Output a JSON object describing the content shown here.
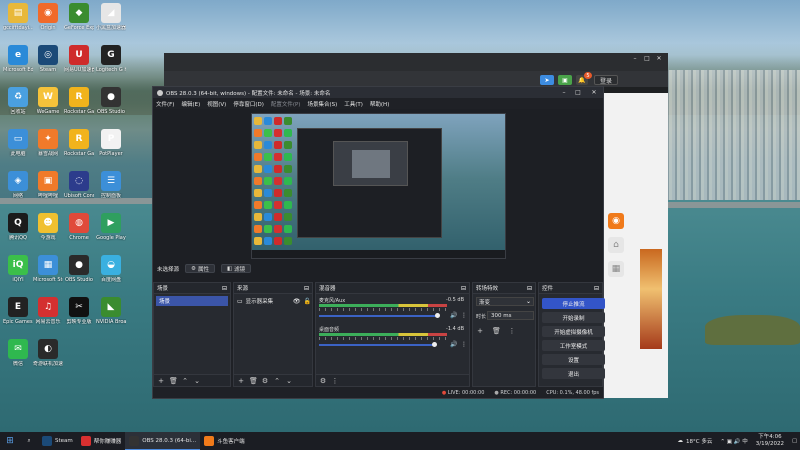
{
  "desktop_icons": [
    {
      "label": "gccifftdayi...",
      "icon": "folder-icon",
      "glyph": "▤",
      "color": "#e8b83a"
    },
    {
      "label": "Origin",
      "icon": "origin-icon",
      "glyph": "◉",
      "color": "#f06a2a"
    },
    {
      "label": "GeForce Experience",
      "icon": "geforce-icon",
      "glyph": "◆",
      "color": "#3a8c2f"
    },
    {
      "label": "小黑盒加速器",
      "icon": "heybox-icon",
      "glyph": "◢",
      "color": "#e6e6e6"
    },
    {
      "label": "Microsoft Edge",
      "icon": "edge-icon",
      "glyph": "e",
      "color": "#2a8ad8"
    },
    {
      "label": "Steam",
      "icon": "steam-icon",
      "glyph": "◎",
      "color": "#1b4a78"
    },
    {
      "label": "网易UU加速器",
      "icon": "uu-icon",
      "glyph": "U",
      "color": "#cf2b2b"
    },
    {
      "label": "Logitech G HUB",
      "icon": "ghub-icon",
      "glyph": "G",
      "color": "#222222"
    },
    {
      "label": "回收站",
      "icon": "recycle-bin-icon",
      "glyph": "♻",
      "color": "#4aa0e0"
    },
    {
      "label": "WeGame",
      "icon": "wegame-icon",
      "glyph": "W",
      "color": "#f5c23a"
    },
    {
      "label": "Rockstar Games",
      "icon": "rockstar-icon",
      "glyph": "R",
      "color": "#f1b31c"
    },
    {
      "label": "OBS Studio",
      "icon": "obs-icon",
      "glyph": "●",
      "color": "#333333"
    },
    {
      "label": "此电脑",
      "icon": "computer-icon",
      "glyph": "▭",
      "color": "#3c8fd8"
    },
    {
      "label": "暴雪战网",
      "icon": "battlenet-icon",
      "glyph": "✦",
      "color": "#f07a2a"
    },
    {
      "label": "Rockstar Games",
      "icon": "rockstar-icon",
      "glyph": "R",
      "color": "#f1b31c"
    },
    {
      "label": "PotPlayer",
      "icon": "potplayer-icon",
      "glyph": "P",
      "color": "#f2f2f2"
    },
    {
      "label": "网络",
      "icon": "network-icon",
      "glyph": "◈",
      "color": "#3c8fd8"
    },
    {
      "label": "哔哩哔哩",
      "icon": "bilibili-icon",
      "glyph": "▣",
      "color": "#f07a2a"
    },
    {
      "label": "Ubisoft Connect",
      "icon": "ubisoft-icon",
      "glyph": "◌",
      "color": "#2c3c8c"
    },
    {
      "label": "控制面板",
      "icon": "control-panel-icon",
      "glyph": "☰",
      "color": "#3c8fd8"
    },
    {
      "label": "腾讯QQ",
      "icon": "qq-icon",
      "glyph": "Q",
      "color": "#1b1b1b"
    },
    {
      "label": "今游戏",
      "icon": "game-icon",
      "glyph": "☻",
      "color": "#f0c030"
    },
    {
      "label": "Chrome",
      "icon": "chrome-icon",
      "glyph": "◍",
      "color": "#e04a3a"
    },
    {
      "label": "Google Play",
      "icon": "play-icon",
      "glyph": "▶",
      "color": "#2f9f5f"
    },
    {
      "label": "iQIYI",
      "icon": "iqiyi-icon",
      "glyph": "iQ",
      "color": "#3bbf4a"
    },
    {
      "label": "Microsoft Store",
      "icon": "store-icon",
      "glyph": "▦",
      "color": "#3c8fd8"
    },
    {
      "label": "OBS Studio",
      "icon": "obs-icon",
      "glyph": "●",
      "color": "#2a2a2a"
    },
    {
      "label": "百度网盘",
      "icon": "baidu-icon",
      "glyph": "◒",
      "color": "#3ab0e0"
    },
    {
      "label": "Epic Games Launcher",
      "icon": "epic-icon",
      "glyph": "E",
      "color": "#222222"
    },
    {
      "label": "网易云音乐",
      "icon": "netease-music-icon",
      "glyph": "♫",
      "color": "#d43030"
    },
    {
      "label": "剪映专业版",
      "icon": "capcut-icon",
      "glyph": "✂",
      "color": "#111111"
    },
    {
      "label": "NVIDIA Broadcast",
      "icon": "nvidia-icon",
      "glyph": "◣",
      "color": "#3a8c2f"
    },
    {
      "label": "微信",
      "icon": "wechat-icon",
      "glyph": "✉",
      "color": "#2fb84f"
    },
    {
      "label": "奇游联机加速器",
      "icon": "qiyou-icon",
      "glyph": "◐",
      "color": "#2a2a2a"
    }
  ],
  "browser": {
    "toolbar_badge": "5",
    "toolbar_button": "登录",
    "side_buttons": [
      {
        "icon": "record-icon",
        "glyph": "◉",
        "color": "#f07a1a"
      },
      {
        "icon": "home-icon",
        "glyph": "⌂",
        "color": "#888888"
      },
      {
        "icon": "qr-icon",
        "glyph": "▦",
        "color": "#888888"
      }
    ]
  },
  "obs": {
    "title": "OBS 28.0.3 (64-bit, windows) - 配置文件: 未命名 - 场景: 未命名",
    "menu": [
      "文件(F)",
      "编辑(E)",
      "视图(V)",
      "停靠窗口(D)",
      "配置文件(P)",
      "场景集合(S)",
      "工具(T)",
      "帮助(H)"
    ],
    "scene_bar": {
      "label": "未选择源",
      "properties": "属性",
      "filters": "滤镜"
    },
    "scenes": {
      "title": "场景",
      "items": [
        "场景"
      ]
    },
    "sources": {
      "title": "来源",
      "items": [
        "显示器采集"
      ]
    },
    "mixer": {
      "title": "混音器",
      "tracks": [
        {
          "name": "麦克风/Aux",
          "db": "-0.5 dB"
        },
        {
          "name": "桌面音频",
          "db": "-1.4 dB"
        }
      ]
    },
    "transitions": {
      "title": "转场特效",
      "type": "渐变",
      "duration_label": "时长",
      "duration": "300 ms"
    },
    "controls": {
      "title": "控件",
      "buttons": [
        "停止推流",
        "开始录制",
        "开始虚拟摄像机",
        "工作室模式",
        "设置",
        "退出"
      ]
    },
    "status": {
      "live": "LIVE: 00:00:00",
      "rec": "REC: 00:00:00",
      "cpu": "CPU: 0.1%, 48.00 fps"
    }
  },
  "taskbar": {
    "items": [
      {
        "label": "Steam",
        "icon": "steam-icon",
        "color": "#1b4a78"
      },
      {
        "label": "帮你赚赚器",
        "icon": "app-icon",
        "color": "#d83030"
      },
      {
        "label": "OBS 28.0.3 (64-bi...",
        "icon": "obs-icon",
        "color": "#333333"
      },
      {
        "label": "斗鱼客户端",
        "icon": "douyu-icon",
        "color": "#f07a1a"
      }
    ],
    "weather": "18°C 多云",
    "time": "下午4:06",
    "date": "3/19/2022"
  }
}
